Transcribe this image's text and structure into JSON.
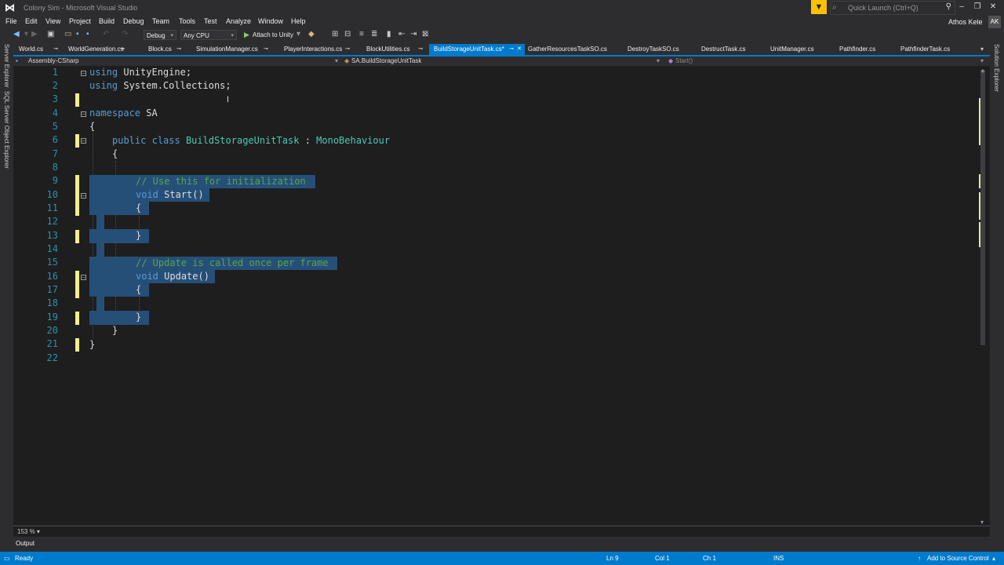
{
  "window": {
    "title": "Colony Sim - Microsoft Visual Studio",
    "quick_launch_placeholder": "Quick Launch (Ctrl+Q)",
    "user_name": "Athos Kele",
    "user_initials": "AK",
    "min_glyph": "–",
    "max_glyph": "❐",
    "close_glyph": "✕"
  },
  "menu": [
    "File",
    "Edit",
    "View",
    "Project",
    "Build",
    "Debug",
    "Team",
    "Tools",
    "Test",
    "Analyze",
    "Window",
    "Help"
  ],
  "toolbar": {
    "configuration": "Debug",
    "platform": "Any CPU",
    "attach_label": "Attach to Unity"
  },
  "side_panels": {
    "left": [
      "Server Explorer",
      "SQL Server Object Explorer"
    ],
    "right": [
      "Solution Explorer"
    ]
  },
  "tabs": [
    {
      "label": "World.cs",
      "active": false
    },
    {
      "label": "WorldGeneration.cs",
      "active": false
    },
    {
      "label": "Block.cs",
      "active": false
    },
    {
      "label": "SimulationManager.cs",
      "active": false
    },
    {
      "label": "PlayerInteractions.cs",
      "active": false
    },
    {
      "label": "BlockUtilities.cs",
      "active": false
    },
    {
      "label": "BuildStorageUnitTask.cs*",
      "active": true
    },
    {
      "label": "GatherResourcesTaskSO.cs",
      "active": false
    },
    {
      "label": "DestroyTaskSO.cs",
      "active": false
    },
    {
      "label": "DestructTask.cs",
      "active": false
    },
    {
      "label": "UnitManager.cs",
      "active": false
    },
    {
      "label": "Pathfinder.cs",
      "active": false
    },
    {
      "label": "PathfinderTask.cs",
      "active": false
    }
  ],
  "navbar": {
    "project": "Assembly-CSharp",
    "type": "SA.BuildStorageUnitTask",
    "member": "Start()"
  },
  "code": {
    "line_numbers": [
      "1",
      "2",
      "3",
      "4",
      "5",
      "6",
      "7",
      "8",
      "9",
      "10",
      "11",
      "12",
      "13",
      "14",
      "15",
      "16",
      "17",
      "18",
      "19",
      "20",
      "21",
      "22"
    ],
    "tokens": {
      "using": "using",
      "unityengine": "UnityEngine;",
      "system_collections": "System.Collections;",
      "namespace": "namespace",
      "ns_name": "SA",
      "open_brace": "{",
      "close_brace": "}",
      "public": "public",
      "class": "class",
      "class_name": "BuildStorageUnitTask",
      "colon": ":",
      "base_class": "MonoBehaviour",
      "comment_init": "// Use this for initialization",
      "void": "void",
      "start_call": "Start()",
      "comment_update": "// Update is called once per frame",
      "update_call": "Update()"
    }
  },
  "zoom": "153 %",
  "output_tab": "Output",
  "status": {
    "state": "Ready",
    "line": "Ln 9",
    "col": "Col 1",
    "ch": "Ch 1",
    "mode": "INS",
    "source_control": "Add to Source Control"
  },
  "colors": {
    "accent": "#007acc",
    "keyword": "#569cd6",
    "type": "#4ec9b0",
    "comment": "#57a64a",
    "line_number": "#2b91af",
    "selection": "#264f78",
    "change_mark": "#efef91"
  }
}
